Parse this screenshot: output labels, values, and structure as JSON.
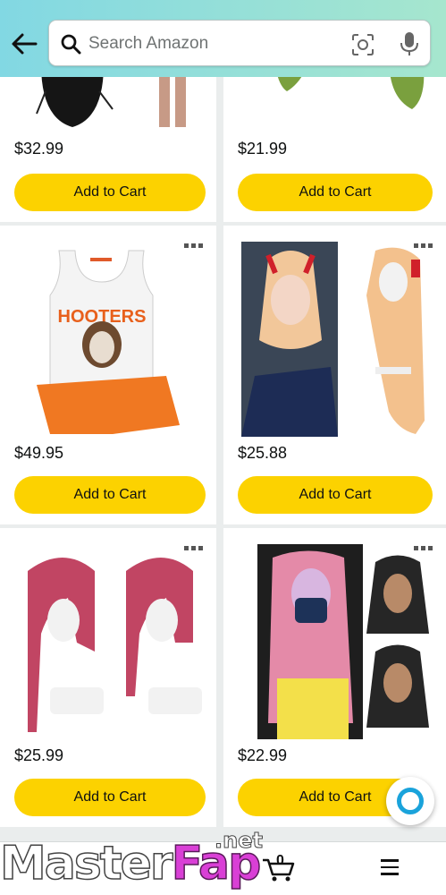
{
  "search": {
    "placeholder": "Search Amazon"
  },
  "products": [
    {
      "price": "$32.99",
      "button": "Add to Cart"
    },
    {
      "price": "$21.99",
      "button": "Add to Cart"
    },
    {
      "price": "$49.95",
      "button": "Add to Cart",
      "image_text": "HOOTERS"
    },
    {
      "price": "$25.88",
      "button": "Add to Cart"
    },
    {
      "price": "$25.99",
      "button": "Add to Cart"
    },
    {
      "price": "$22.99",
      "button": "Add to Cart"
    }
  ],
  "bottom_nav": {
    "cart_count": "0"
  },
  "watermark": {
    "word1": "Master",
    "word2": "Fap",
    "suffix": ".net"
  },
  "icons": [
    "back-arrow-icon",
    "search-icon",
    "camera-lens-icon",
    "microphone-icon",
    "more-options-icon",
    "alexa-icon",
    "cart-icon",
    "menu-icon"
  ],
  "colors": {
    "header_start": "#82d8e3",
    "header_end": "#a6e6ce",
    "button": "#fcd200",
    "alexa": "#1aa3db"
  }
}
